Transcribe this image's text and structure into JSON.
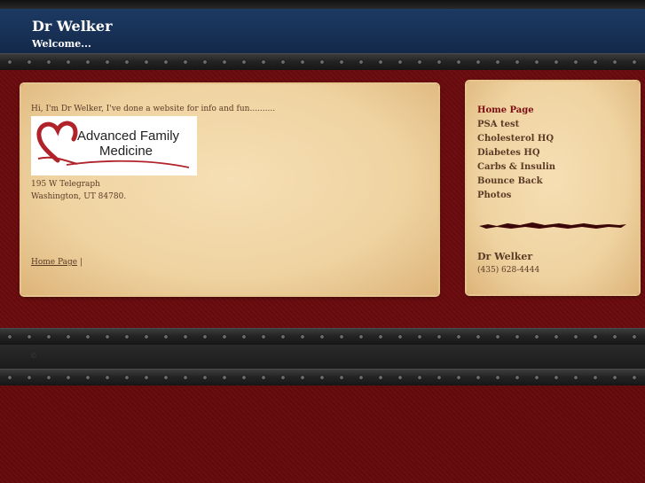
{
  "header": {
    "title": "Dr Welker",
    "subtitle": "Welcome..."
  },
  "main": {
    "intro": "Hi, I'm Dr Welker, I've done a website for info and fun..........",
    "logo": {
      "line1": "Advanced Family",
      "line2": "Medicine",
      "icon": "heart-logo-icon",
      "heart_color": "#b0232a"
    },
    "address_line1": "195 W Telegraph",
    "address_line2": "Washington, UT 84780.",
    "breadcrumb": {
      "link": "Home Page",
      "separator": "|"
    }
  },
  "sidebar": {
    "nav": [
      {
        "label": "Home Page",
        "active": true
      },
      {
        "label": "PSA test",
        "active": false
      },
      {
        "label": "Cholesterol HQ",
        "active": false
      },
      {
        "label": "Diabetes HQ",
        "active": false
      },
      {
        "label": "Carbs & Insulin",
        "active": false
      },
      {
        "label": "Bounce Back",
        "active": false
      },
      {
        "label": "Photos",
        "active": false
      }
    ],
    "contact_name": "Dr Welker",
    "contact_phone": "(435) 628-4444"
  },
  "footer": {
    "mark": "©"
  },
  "colors": {
    "header_bg": "#1d3a63",
    "page_bg": "#6b0b0e",
    "parchment": "#f2d7a6",
    "text": "#5a3b26",
    "active_link": "#7a0d12"
  }
}
